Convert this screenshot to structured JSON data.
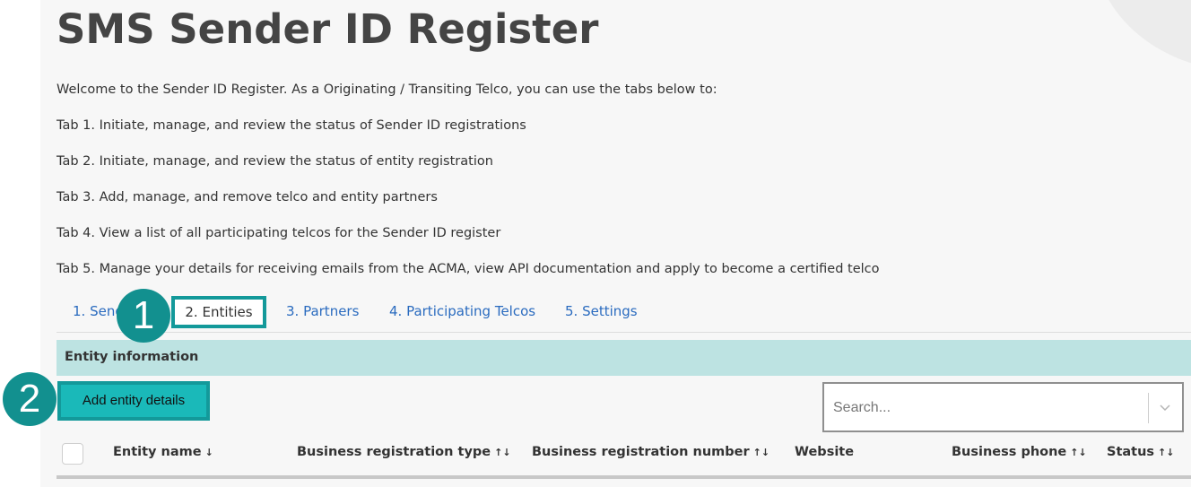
{
  "page": {
    "title": "SMS Sender ID Register",
    "intro": [
      "Welcome to the Sender ID Register. As a Originating / Transiting Telco, you can use the tabs below to:",
      "Tab 1. Initiate, manage, and review the status of Sender ID registrations",
      "Tab 2. Initiate, manage, and review the status of entity registration",
      "Tab 3. Add, manage, and remove telco and entity partners",
      "Tab 4. View a list of all participating telcos for the Sender ID register",
      "Tab 5. Manage your details for receiving emails from the ACMA, view API documentation and apply to become a certified telco"
    ]
  },
  "tabs": [
    {
      "label": "1. Sender IDs",
      "visible_label": "1. Send",
      "active": false
    },
    {
      "label": "2. Entities",
      "active": true
    },
    {
      "label": "3. Partners",
      "active": false
    },
    {
      "label": "4. Participating Telcos",
      "active": false
    },
    {
      "label": "5. Settings",
      "active": false
    }
  ],
  "section": {
    "title": "Entity information"
  },
  "actions": {
    "add_entity_label": "Add entity details"
  },
  "search": {
    "placeholder": "Search..."
  },
  "table": {
    "columns": [
      {
        "label": "Entity name",
        "sort": "↓"
      },
      {
        "label": "Business registration type",
        "sort": "↑↓"
      },
      {
        "label": "Business registration number",
        "sort": "↑↓"
      },
      {
        "label": "Website",
        "sort": ""
      },
      {
        "label": "Business phone",
        "sort": "↑↓"
      },
      {
        "label": "Status",
        "sort": "↑↓"
      }
    ]
  },
  "annotations": [
    {
      "label": "1"
    },
    {
      "label": "2"
    }
  ],
  "colors": {
    "accent": "#13999a",
    "button_fill": "#1ab9b9",
    "section_bar": "#bde3e2",
    "tab_link": "#2a6bbf",
    "badge": "#12908f"
  },
  "icons": {
    "search_dropdown": "chevron-down-icon"
  }
}
